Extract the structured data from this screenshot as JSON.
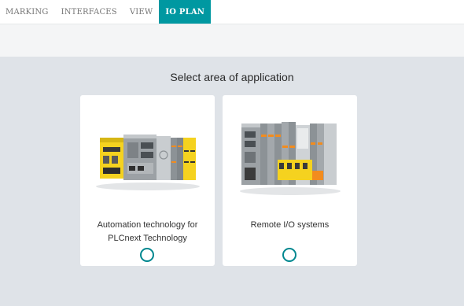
{
  "nav": {
    "tabs": [
      {
        "label": "MARKING",
        "active": false
      },
      {
        "label": "INTERFACES",
        "active": false
      },
      {
        "label": "VIEW",
        "active": false
      },
      {
        "label": "IO PLAN",
        "active": true
      }
    ]
  },
  "main": {
    "heading": "Select area of application",
    "cards": [
      {
        "label": "Automation technology for PLCnext Technology",
        "selected": false
      },
      {
        "label": "Remote I/O systems",
        "selected": false
      }
    ]
  },
  "colors": {
    "accent": "#0098a1",
    "background": "#dfe3e8",
    "module_yellow": "#f5d21f",
    "module_grey": "#8c9296"
  }
}
